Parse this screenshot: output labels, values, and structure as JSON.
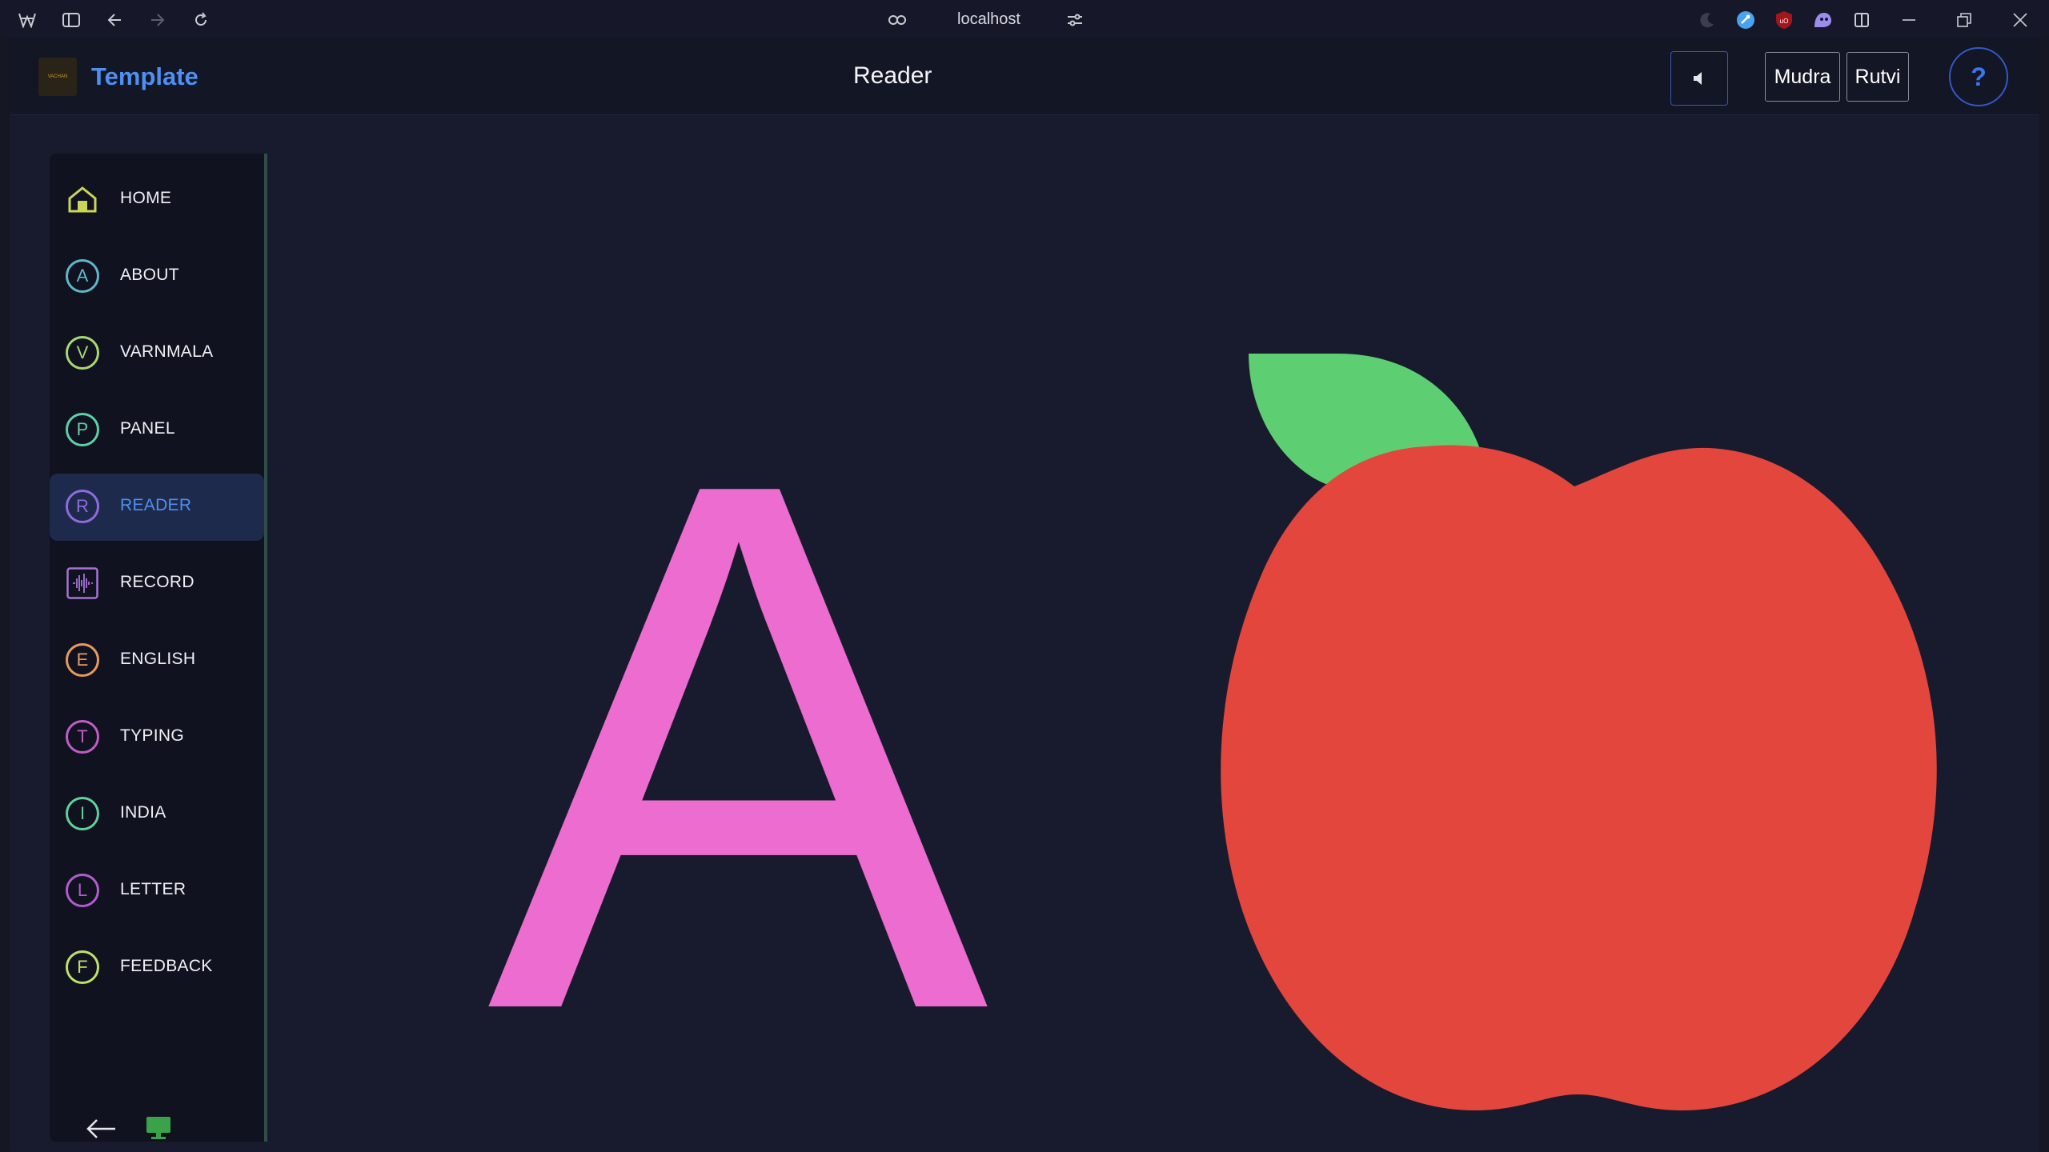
{
  "browser": {
    "url": "localhost"
  },
  "header": {
    "brand": "Template",
    "logo_text": "VACHAN",
    "title": "Reader",
    "users": [
      "Mudra",
      "Rutvi"
    ],
    "help": "?"
  },
  "sidebar": {
    "items": [
      {
        "label": "HOME",
        "letter": "",
        "color": "#cbd55a"
      },
      {
        "label": "ABOUT",
        "letter": "A",
        "color": "#5fb7c7"
      },
      {
        "label": "VARNMALA",
        "letter": "V",
        "color": "#a8d872"
      },
      {
        "label": "PANEL",
        "letter": "P",
        "color": "#5fd0a6"
      },
      {
        "label": "READER",
        "letter": "R",
        "color": "#8f6ae0"
      },
      {
        "label": "RECORD",
        "letter": "",
        "color": "#a673d9"
      },
      {
        "label": "ENGLISH",
        "letter": "E",
        "color": "#e89a5e"
      },
      {
        "label": "TYPING",
        "letter": "T",
        "color": "#c05cc8"
      },
      {
        "label": "INDIA",
        "letter": "I",
        "color": "#62d09a"
      },
      {
        "label": "LETTER",
        "letter": "L",
        "color": "#b35ad0"
      },
      {
        "label": "FEEDBACK",
        "letter": "F",
        "color": "#bfe06a"
      }
    ],
    "active": "READER"
  },
  "stage": {
    "letter": "A",
    "letter_color": "#ec6ccf",
    "image": "apple",
    "apple_color": "#e2463d",
    "leaf_color": "#5ece72"
  }
}
